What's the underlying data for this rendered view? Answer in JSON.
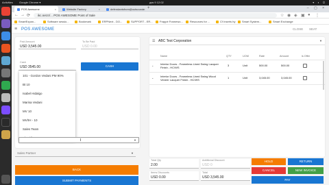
{
  "os": {
    "activities": "Activities",
    "app_menu": "Google Chrome ▾",
    "clock": "дек 9 12:02"
  },
  "browser": {
    "tabs": [
      {
        "label": "POS Awesome",
        "close": "×"
      },
      {
        "label": "Website Factory",
        "close": "×"
      },
      {
        "label": "defendantsfrom@outsourcin",
        "close": "×"
      }
    ],
    "new_tab": "+",
    "window_controls": "– ▢ ×",
    "nav": {
      "back": "←",
      "forward": "→",
      "reload": "⟳"
    },
    "url": "ikc.net.tr/... POS AWESOME  Point of Sale",
    "bookmarks": [
      "SmartExpan...",
      "Software sessio...",
      "Bookmark",
      "ERPNext - DO...",
      "SUPPORT - ER...",
      "Frappé Framewo...",
      "Resources for ...",
      "Cf Inserts by",
      "Smart System...",
      "Smart Exchange"
    ]
  },
  "app": {
    "brand": "POS AWESOME",
    "header_right": [
      "CLOSE",
      "SEAT"
    ]
  },
  "payment": {
    "paid_amount": {
      "label": "Paid Amount",
      "value": "USD 3,545.00"
    },
    "to_be_paid": {
      "label": "To Be Paid",
      "value": "USD 0.00"
    },
    "cash_field": {
      "label": "Cash",
      "value": "USD 3545.00"
    },
    "cash_button": "CASH",
    "dropdown_items": [
      "101 - Gordon Vedani PM 90%",
      "Bt 10",
      "Isabel Hidalgo",
      "Marisa Vedani",
      "MV 10",
      "MV/IH - 10",
      "Sales Team",
      "Charidia ..."
    ],
    "sales_partner_placeholder": "Sales Partner",
    "back_button": "BACK",
    "submit_button": "SUBMIT PAYMENTS"
  },
  "cart": {
    "customer": "ABC Test Corporation",
    "headers": [
      "Name",
      "QTY",
      "UOM",
      "Rate",
      "Amount",
      "is Offer"
    ],
    "items": [
      {
        "name": "Interior Doors - Frameless Lined Swing Lacquer Finish - HC/WS",
        "qty": "3",
        "uom": "Unit",
        "rate": "500.00",
        "amount": "500.00"
      },
      {
        "name": "Interior Doors - Frameless Lined Swing Wood Veneer Lacquer Finish - HC/WS",
        "qty": "1",
        "uom": "Unit",
        "rate": "3,045.00",
        "amount": "3,045.00"
      }
    ],
    "expand_icon": "⌄"
  },
  "totals": {
    "total_qty": {
      "label": "Total Qty",
      "value": "2.00"
    },
    "additional_discount": {
      "label": "Additional Discount",
      "value": "USD 0"
    },
    "item_discounts": {
      "label": "Items Discounts",
      "value": "USD 0.00"
    },
    "total": {
      "label": "Total",
      "value": "USD 3,545.00"
    },
    "buttons": {
      "hold": "HOLD",
      "return": "RETURN",
      "cancel": "CANCEL",
      "new_invoice": "NEW INVOICE",
      "pay": "PAY"
    }
  },
  "colors": {
    "primary": "#1976d2",
    "warning": "#f57c00",
    "success": "#43a047",
    "danger": "#e53935"
  }
}
